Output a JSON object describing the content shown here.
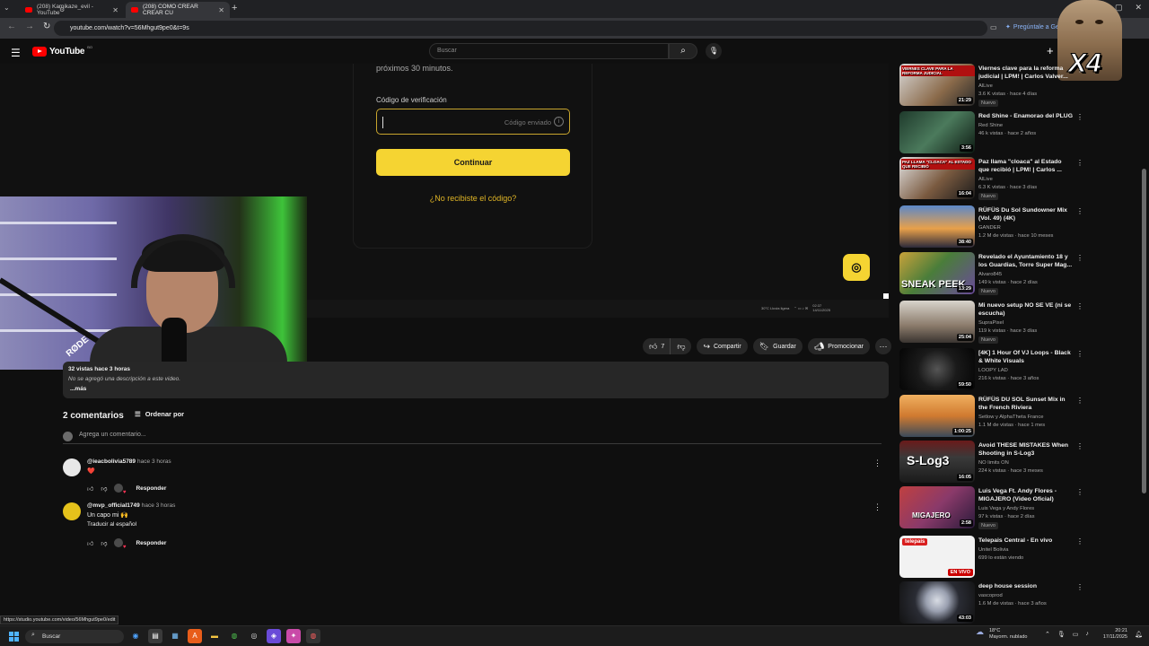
{
  "browser": {
    "tabs": [
      {
        "label": "(208) Kamikaze_evil - YouTube",
        "active": false
      },
      {
        "label": "(208) COMO CREAR CREAR CU",
        "active": true
      }
    ],
    "new_tab": "+",
    "url": "youtube.com/watch?v=56Mhgut9pe0&t=9s",
    "gemini_label": "Pregúntale a Gemini"
  },
  "youtube": {
    "logo_text": "YouTube",
    "logo_region": "BO",
    "search_placeholder": "Buscar",
    "create_label": "+"
  },
  "overlay": {
    "multiplier": "X4"
  },
  "player": {
    "subtext": "próximos 30 minutos.",
    "code_label": "Código de verificación",
    "code_hint": "Código enviado",
    "continue_label": "Continuar",
    "resend_label": "¿No recibiste el código?",
    "webcam_mic_brand": "RØDE",
    "mini_weather": "30°C Lluvia ligera",
    "mini_time": "02:37",
    "mini_date": "14/11/2025"
  },
  "actions": {
    "like_count": "7",
    "share": "Compartir",
    "save": "Guardar",
    "promote": "Promocionar"
  },
  "description": {
    "meta": "32 vistas  hace 3 horas",
    "text": "No se agregó una descripción a este video.",
    "more": "...más"
  },
  "comments": {
    "count_label": "2 comentarios",
    "sort_label": "Ordenar por",
    "add_placeholder": "Agrega un comentario...",
    "items": [
      {
        "author": "@ieacbolivia5789",
        "time": "hace 3 horas",
        "body": "❤️",
        "translate": "",
        "reply": "Responder"
      },
      {
        "author": "@mvp_official1749",
        "time": "hace 3 horas",
        "body": "Un capo mi 🙌",
        "translate": "Traducir al español",
        "reply": "Responder"
      }
    ]
  },
  "sidebar": {
    "items": [
      {
        "title": "Viernes clave para la reforma judicial | LPM! | Carlos Valver...",
        "channel": "AlLive",
        "meta": "3.6 K vistas · hace 4 días",
        "badge": "Nuevo",
        "duration": "21:29",
        "thumb_text": "VIERNES CLAVE PARA LA REFORMA JUDICIAL"
      },
      {
        "title": "Red Shine - Enamorao del PLUG",
        "channel": "Red Shine",
        "meta": "46 k vistas · hace 2 años",
        "badge": "",
        "duration": "3:56",
        "thumb_text": ""
      },
      {
        "title": "Paz llama \"cloaca\" al Estado que recibió | LPM! | Carlos ...",
        "channel": "AlLive",
        "meta": "6.3 K vistas · hace 3 días",
        "badge": "Nuevo",
        "duration": "16:04",
        "thumb_text": "PAZ LLAMA \"CLOACA\" AL ESTADO QUE RECIBIÓ"
      },
      {
        "title": "RÜFÜS Du Sol Sundowner Mix (Vol. 49) (4K)",
        "channel": "GANDER",
        "meta": "1.2 M de vistas · hace 10 meses",
        "badge": "",
        "duration": "38:40",
        "thumb_text": ""
      },
      {
        "title": "Revelado el Ayuntamiento 18 y los Guardias, Torre Super Mag...",
        "channel": "Alvaro845",
        "meta": "149 k vistas · hace 2 días",
        "badge": "Nuevo",
        "duration": "13:29",
        "thumb_text": "SNEAK PEEK"
      },
      {
        "title": "Mi nuevo setup NO SE VE (ni se escucha)",
        "channel": "SupraPixel",
        "meta": "119 k vistas · hace 3 días",
        "badge": "Nuevo",
        "duration": "25:04",
        "thumb_text": ""
      },
      {
        "title": "[4K] 1 Hour Of VJ Loops - Black & White Visuals",
        "channel": "LOOPY LAD",
        "meta": "216 k vistas · hace 3 años",
        "badge": "",
        "duration": "59:50",
        "thumb_text": ""
      },
      {
        "title": "RÜFÜS DU SOL Sunset Mix in the French Riviera",
        "channel": "Setlow y AlphaTheta France",
        "meta": "1.1 M de vistas · hace 1 mes",
        "badge": "",
        "duration": "1:00:25",
        "thumb_text": ""
      },
      {
        "title": "Avoid THESE MISTAKES When Shooting in S-Log3",
        "channel": "NO limits ON",
        "meta": "224 k vistas · hace 3 meses",
        "badge": "",
        "duration": "16:05",
        "thumb_text": "S-Log3"
      },
      {
        "title": "Luis Vega Ft. Andy Flores - MIGAJERO (Video Oficial)",
        "channel": "Luis Vega y Andy Flores",
        "meta": "97 k vistas · hace 2 días",
        "badge": "Nuevo",
        "duration": "2:58",
        "thumb_text": "MIGAJERO"
      },
      {
        "title": "Telepais Central - En vivo",
        "channel": "Unitel Bolivia",
        "meta": "699 lo están viendo",
        "badge": "",
        "duration": "EN VIVO",
        "thumb_text": "telepais"
      },
      {
        "title": "deep house session",
        "channel": "vascoprod",
        "meta": "1.6 M de vistas · hace 3 años",
        "badge": "",
        "duration": "43:03",
        "thumb_text": ""
      }
    ]
  },
  "status_bar": {
    "url": "https://studio.youtube.com/video/56Mhgut9pe0/edit"
  },
  "taskbar": {
    "search_label": "Buscar",
    "weather_temp": "18°C",
    "weather_desc": "Mayorm. nublado",
    "time": "20:21",
    "date": "17/11/2025"
  }
}
